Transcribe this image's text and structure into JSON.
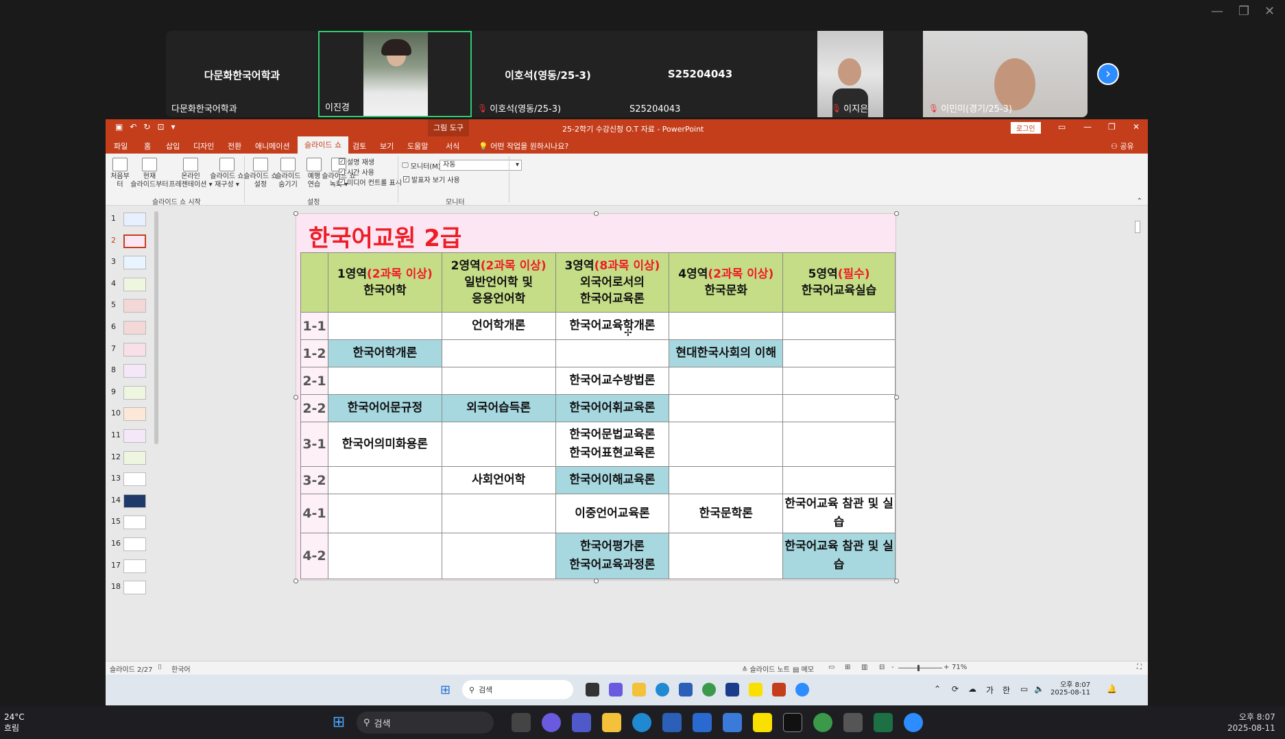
{
  "zoom": {
    "window_controls": [
      "—",
      "❐",
      "✕"
    ],
    "participants": [
      {
        "big_name": "다문화한국어학과",
        "name": "다문화한국어학과",
        "muted": false,
        "video": false
      },
      {
        "big_name": "",
        "name": "이진경",
        "muted": false,
        "video": true
      },
      {
        "big_name": "이호석(영동/25-3)",
        "name": "이호석(영동/25-3)",
        "muted": true,
        "video": false
      },
      {
        "big_name": "S25204043",
        "name": "S25204043",
        "muted": false,
        "video": false
      },
      {
        "big_name": "",
        "name": "이지은",
        "muted": true,
        "video": true
      },
      {
        "big_name": "",
        "name": "이민미(경기/25-3)",
        "muted": true,
        "video": true
      }
    ]
  },
  "ppt": {
    "title_bar": {
      "context_tab": "그림 도구",
      "doc_title": "25-2학기 수강신청 O.T 자료 - PowerPoint",
      "login": "로그인"
    },
    "menu": {
      "items": [
        "파일",
        "홈",
        "삽입",
        "디자인",
        "전환",
        "애니메이션",
        "슬라이드 쇼",
        "검토",
        "보기",
        "도움말",
        "서식"
      ],
      "tell_me": "어떤 작업을 원하시나요?",
      "share": "공유"
    },
    "ribbon": {
      "from_start": [
        "처음부터"
      ],
      "from_current": [
        "현재",
        "슬라이드부터"
      ],
      "online": [
        "온라인",
        "프레젠테이션 ▾"
      ],
      "custom": [
        "슬라이드 쇼",
        "재구성 ▾"
      ],
      "group_start": "슬라이드 쇼 시작",
      "setup": [
        "슬라이드 쇼",
        "설정"
      ],
      "hide": [
        "슬라이드",
        "숨기기"
      ],
      "rehearse": [
        "예행",
        "연습"
      ],
      "record": [
        "슬라이드 쇼",
        "녹화 ▾"
      ],
      "check_narration": "설명 재생",
      "check_timing": "시간 사용",
      "check_media": "미디어 컨트롤 표시",
      "group_setup": "설정",
      "monitor_label": "모니터(M):",
      "monitor_value": "자동",
      "presenter_view": "발표자 보기 사용",
      "group_monitor": "모니터"
    },
    "thumb_numbers": [
      "1",
      "2",
      "3",
      "4",
      "5",
      "6",
      "7",
      "8",
      "9",
      "10",
      "11",
      "12",
      "13",
      "14",
      "15",
      "16",
      "17",
      "18"
    ],
    "status": {
      "slide_pos": "슬라이드 2/27",
      "language": "한국어",
      "notes": "슬라이드 노트",
      "comments": "메모",
      "zoom_pct": "71%"
    }
  },
  "slide": {
    "title": "한국어교원 2급",
    "header": [
      {
        "l1": "1영역",
        "l1r": "(2과목 이상)",
        "l2": "한국어학",
        "l3": ""
      },
      {
        "l1": "2영역",
        "l1r": "(2과목 이상)",
        "l2": "일반언어학 및",
        "l3": "응용언어학"
      },
      {
        "l1": "3영역",
        "l1r": "(8과목 이상)",
        "l2": "외국어로서의",
        "l3": "한국어교육론"
      },
      {
        "l1": "4영역",
        "l1r": "(2과목 이상)",
        "l2": "한국문화",
        "l3": ""
      },
      {
        "l1": "5영역",
        "l1r": "(필수)",
        "l2": "한국어교육실습",
        "l3": ""
      }
    ],
    "rows": [
      {
        "label": "1-1",
        "cells": [
          {
            "t": "",
            "c": false
          },
          {
            "t": "언어학개론",
            "c": false
          },
          {
            "t": "한국어교육학개론",
            "c": false
          },
          {
            "t": "",
            "c": false
          },
          {
            "t": "",
            "c": false
          }
        ]
      },
      {
        "label": "1-2",
        "cells": [
          {
            "t": "한국어학개론",
            "c": true
          },
          {
            "t": "",
            "c": false
          },
          {
            "t": "",
            "c": false
          },
          {
            "t": "현대한국사회의 이해",
            "c": true
          },
          {
            "t": "",
            "c": false
          }
        ]
      },
      {
        "label": "2-1",
        "cells": [
          {
            "t": "",
            "c": false
          },
          {
            "t": "",
            "c": false
          },
          {
            "t": "한국어교수방법론",
            "c": false
          },
          {
            "t": "",
            "c": false
          },
          {
            "t": "",
            "c": false
          }
        ]
      },
      {
        "label": "2-2",
        "cells": [
          {
            "t": "한국어어문규정",
            "c": true
          },
          {
            "t": "외국어습득론",
            "c": true
          },
          {
            "t": "한국어어휘교육론",
            "c": true
          },
          {
            "t": "",
            "c": false
          },
          {
            "t": "",
            "c": false
          }
        ]
      },
      {
        "label": "3-1",
        "cells": [
          {
            "t": "한국어의미화용론",
            "c": false
          },
          {
            "t": "",
            "c": false
          },
          {
            "t": "한국어문법교육론\n한국어표현교육론",
            "c": false
          },
          {
            "t": "",
            "c": false
          },
          {
            "t": "",
            "c": false
          }
        ]
      },
      {
        "label": "3-2",
        "cells": [
          {
            "t": "",
            "c": false
          },
          {
            "t": "사회언어학",
            "c": false
          },
          {
            "t": "한국어이해교육론",
            "c": true
          },
          {
            "t": "",
            "c": false
          },
          {
            "t": "",
            "c": false
          }
        ]
      },
      {
        "label": "4-1",
        "cells": [
          {
            "t": "",
            "c": false
          },
          {
            "t": "",
            "c": false
          },
          {
            "t": "이중언어교육론",
            "c": false
          },
          {
            "t": "한국문학론",
            "c": false
          },
          {
            "t": "한국어교육 참관 및 실\n습",
            "c": false
          }
        ]
      },
      {
        "label": "4-2",
        "cells": [
          {
            "t": "",
            "c": false
          },
          {
            "t": "",
            "c": false
          },
          {
            "t": "한국어평가론\n한국어교육과정론",
            "c": true
          },
          {
            "t": "",
            "c": false
          },
          {
            "t": "한국어교육 참관 및 실\n습",
            "c": true
          }
        ]
      }
    ]
  },
  "inner_taskbar": {
    "search": "검색",
    "tray": [
      "가",
      "한"
    ],
    "time": "오후 8:07",
    "date": "2025-08-11"
  },
  "taskbar": {
    "weather_temp": "24°C",
    "weather_desc": "흐림",
    "search": "검색",
    "time": "오후 8:07",
    "date": "2025-08-11"
  },
  "colors": {
    "ppt_accent": "#c43e1c",
    "zoom_active": "#2ecc71",
    "header_green": "#c5dd86",
    "cell_cyan": "#a7d8e0",
    "title_red": "#ee1c25",
    "slide_bg": "#fde6f4"
  }
}
